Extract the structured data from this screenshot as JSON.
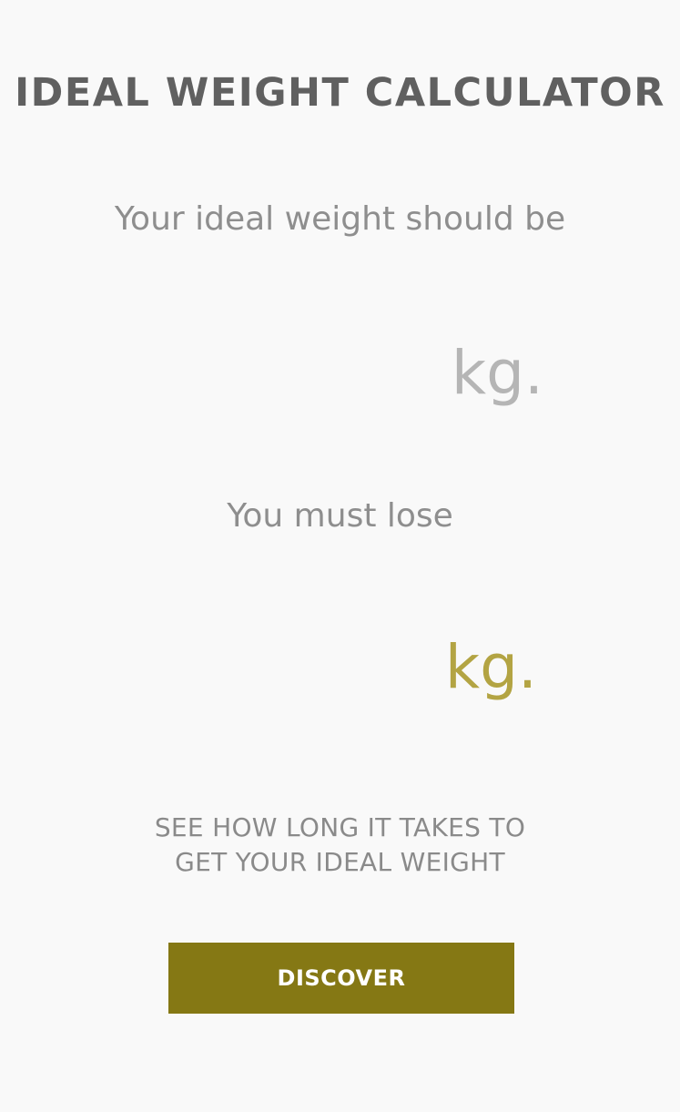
{
  "header": {
    "title": "IDEAL WEIGHT CALCULATOR"
  },
  "ideal_weight": {
    "label": "Your ideal weight should be",
    "value": "",
    "unit": "kg."
  },
  "weight_to_lose": {
    "label": "You must lose",
    "value": "",
    "unit": "kg."
  },
  "cta": {
    "line1": "SEE HOW LONG IT TAKES TO",
    "line2": "GET YOUR IDEAL WEIGHT",
    "button_label": "DISCOVER"
  },
  "colors": {
    "background": "#f9f9f9",
    "title": "#606060",
    "accent": "#857814",
    "accent_text": "#b3a443",
    "muted_text": "#8e8e8e"
  }
}
